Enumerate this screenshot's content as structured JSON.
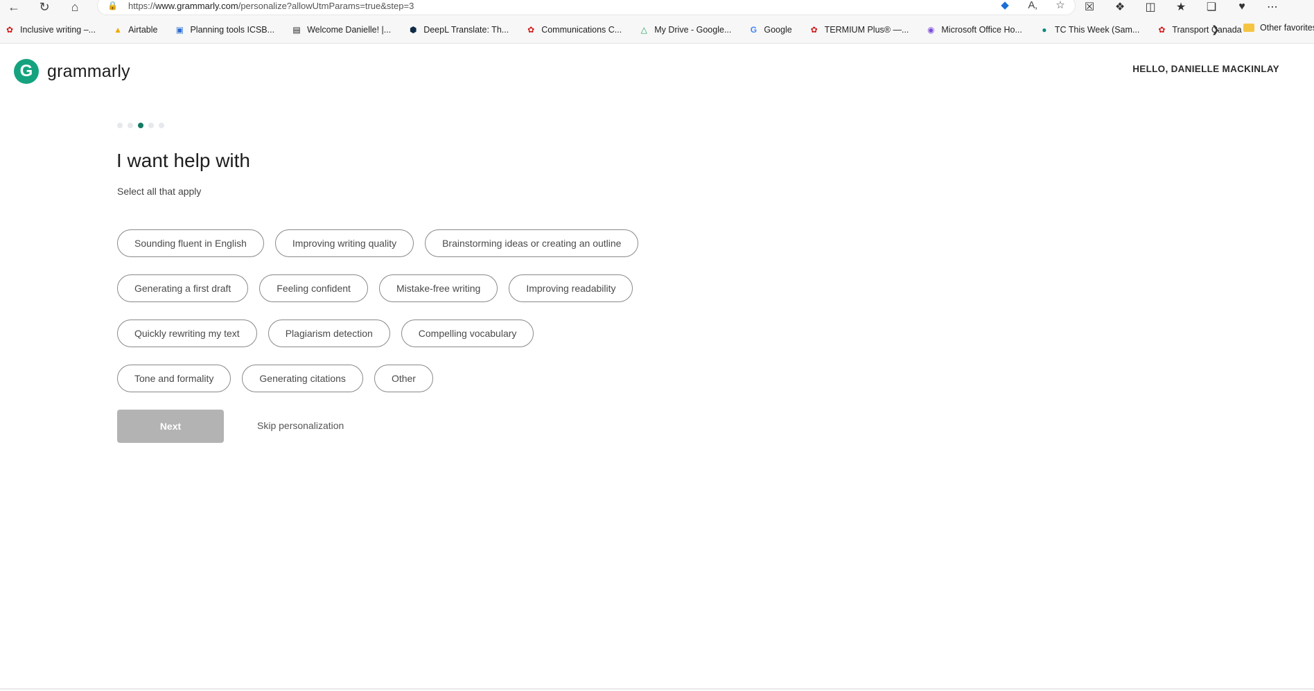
{
  "browser": {
    "url_prefix": "https://",
    "url_host": "www.grammarly.com",
    "url_path": "/personalize?allowUtmParams=true&step=3",
    "bookmarks": [
      {
        "label": "Inclusive writing –...",
        "icon": "maple-leaf-icon"
      },
      {
        "label": "Airtable",
        "icon": "airtable-icon"
      },
      {
        "label": "Planning tools ICSB...",
        "icon": "app-icon"
      },
      {
        "label": "Welcome Danielle! |...",
        "icon": "trello-icon"
      },
      {
        "label": "DeepL Translate: Th...",
        "icon": "deepl-icon"
      },
      {
        "label": "Communications C...",
        "icon": "maple-leaf-icon"
      },
      {
        "label": "My Drive - Google...",
        "icon": "google-drive-icon"
      },
      {
        "label": "Google",
        "icon": "google-icon"
      },
      {
        "label": "TERMIUM Plus® —...",
        "icon": "maple-leaf-icon"
      },
      {
        "label": "Microsoft Office Ho...",
        "icon": "office-icon"
      },
      {
        "label": "TC This Week (Sam...",
        "icon": "sharepoint-icon"
      },
      {
        "label": "Transport Canada",
        "icon": "maple-leaf-icon"
      }
    ],
    "other_favorites": "Other favorites"
  },
  "header": {
    "logo_text": "grammarly",
    "greeting": "HELLO, DANIELLE MACKINLAY"
  },
  "progress": {
    "total_steps": 5,
    "current_step": 3
  },
  "main": {
    "title": "I want help with",
    "subtitle": "Select all that apply",
    "option_rows": [
      [
        "Sounding fluent in English",
        "Improving writing quality",
        "Brainstorming ideas or creating an outline"
      ],
      [
        "Generating a first draft",
        "Feeling confident",
        "Mistake-free writing",
        "Improving readability"
      ],
      [
        "Quickly rewriting my text",
        "Plagiarism detection",
        "Compelling vocabulary"
      ],
      [
        "Tone and formality",
        "Generating citations",
        "Other"
      ]
    ],
    "next_label": "Next",
    "skip_label": "Skip personalization"
  },
  "colors": {
    "brand": "#15a37f",
    "active_dot": "#137a63",
    "next_disabled": "#b3b3b3"
  }
}
